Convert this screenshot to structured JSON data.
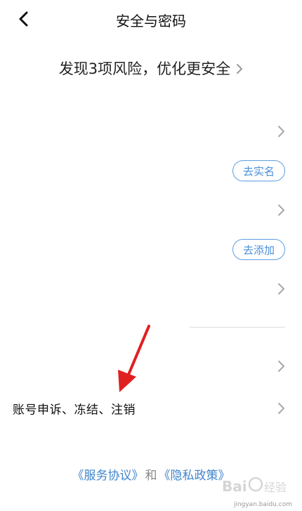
{
  "navbar": {
    "title": "安全与密码",
    "back_icon": "chevron-left-icon"
  },
  "risk_banner": {
    "text": "发现3项风险，优化更安全"
  },
  "rows": {
    "verify_button": "去实名",
    "add_button": "去添加",
    "account_appeal": "账号申诉、冻结、注销"
  },
  "footer": {
    "service_agreement": "《服务协议》",
    "conjunction": "和",
    "privacy_policy": "《隐私政策》"
  },
  "watermark": {
    "brand": "Baidu经验",
    "url": "jingyan.baidu.com"
  },
  "colors": {
    "accent": "#4a8fd8",
    "annotation_arrow": "#e02020"
  }
}
